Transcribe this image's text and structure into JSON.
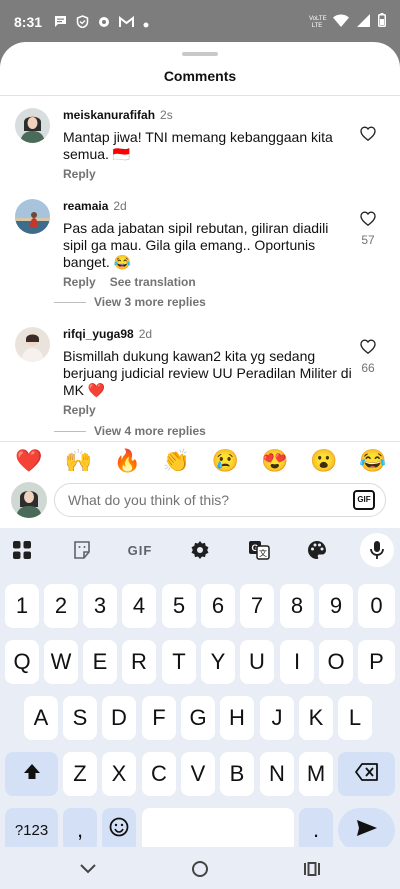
{
  "status": {
    "time": "8:31",
    "volte_top": "VoLTE",
    "volte_bottom": "LTE"
  },
  "sheet": {
    "title": "Comments"
  },
  "comments": [
    {
      "username": "meiskanurafifah",
      "time": "2s",
      "text": "Mantap jiwa! TNI memang kebanggaan kita semua. 🇮🇩",
      "reply_label": "Reply",
      "likes": ""
    },
    {
      "username": "reamaia",
      "time": "2d",
      "text": "Pas ada jabatan sipil rebutan, giliran diadili sipil ga mau. Gila gila emang.. Oportunis banget. 😂",
      "reply_label": "Reply",
      "translate_label": "See translation",
      "likes": "57",
      "more_replies": "View 3 more replies"
    },
    {
      "username": "rifqi_yuga98",
      "time": "2d",
      "text": "Bismillah dukung kawan2 kita yg sedang berjuang judicial review UU Peradilan Militer di MK ❤️",
      "reply_label": "Reply",
      "likes": "66",
      "more_replies": "View 4 more replies"
    }
  ],
  "reactions": [
    "❤️",
    "🙌",
    "🔥",
    "👏",
    "😢",
    "😍",
    "😮",
    "😂"
  ],
  "input": {
    "placeholder": "What do you think of this?",
    "gif_label": "GIF"
  },
  "keyboard": {
    "toolbar": {
      "gif_label": "GIF"
    },
    "row_numbers": [
      "1",
      "2",
      "3",
      "4",
      "5",
      "6",
      "7",
      "8",
      "9",
      "0"
    ],
    "row_1": [
      "Q",
      "W",
      "E",
      "R",
      "T",
      "Y",
      "U",
      "I",
      "O",
      "P"
    ],
    "row_2": [
      "A",
      "S",
      "D",
      "F",
      "G",
      "H",
      "J",
      "K",
      "L"
    ],
    "row_3": [
      "Z",
      "X",
      "C",
      "V",
      "B",
      "N",
      "M"
    ],
    "symbols_label": "?123",
    "comma": ",",
    "period": "."
  },
  "colors": {
    "sheet_bg": "#ffffff",
    "keyboard_bg": "#e9eef6",
    "function_key": "#d3e0f5",
    "secondary_text": "#737373"
  },
  "icons": {
    "statusbar": [
      "chat-bubble-icon",
      "shield-icon",
      "nfc-icon",
      "gmail-icon",
      "dot-icon",
      "volte-icon",
      "wifi-icon",
      "signal-icon",
      "battery-icon"
    ],
    "comment_like": "heart-outline-icon",
    "keyboard_toolbar": [
      "apps-grid-icon",
      "sticker-icon",
      "gif-icon",
      "settings-gear-icon",
      "translate-icon",
      "palette-icon",
      "microphone-icon"
    ],
    "keyboard_special": [
      "shift-icon",
      "backspace-icon",
      "emoji-icon",
      "send-arrow-icon"
    ],
    "navigation": [
      "back-chevron-icon",
      "home-circle-icon",
      "recents-icon"
    ]
  }
}
